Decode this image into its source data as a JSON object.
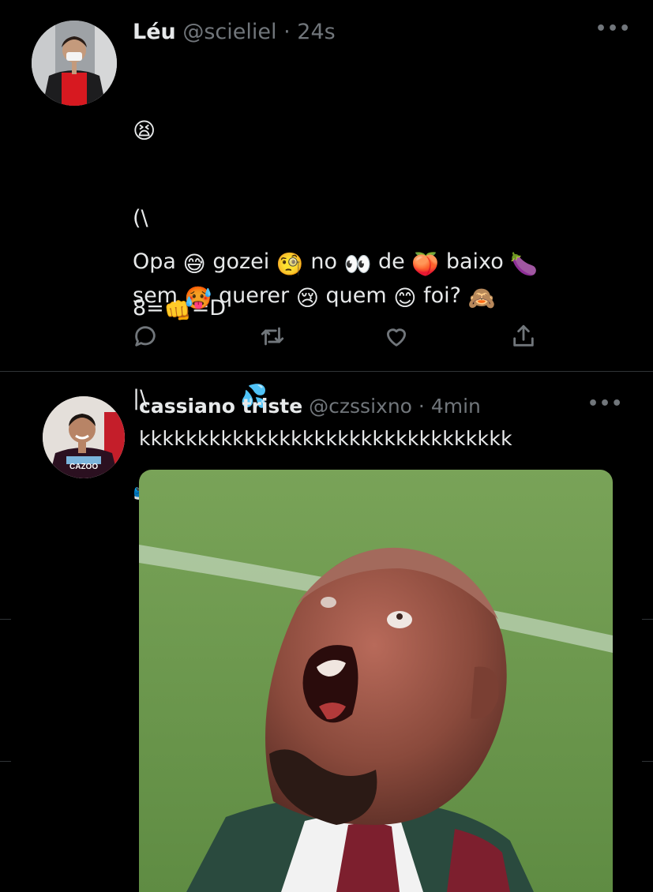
{
  "tweets": [
    {
      "display_name": "Léu",
      "handle": "@scieliel",
      "separator": "·",
      "time": "24s",
      "more": "•••",
      "lines": [
        {
          "text": "(\\"
        },
        {
          "left": "8=",
          "right": "=D"
        },
        {
          "text": "|\\"
        }
      ],
      "sentence": {
        "w1": "Opa",
        "w2": "gozei",
        "w3": "no",
        "w4": "de",
        "w5": "baixo",
        "w6": "sem",
        "w7": "querer",
        "w8": "quem",
        "w9": "foi?"
      },
      "icons": {
        "tired": "tired-face-emoji",
        "fist": "oncoming-fist-emoji",
        "sweat": "sweat-droplets-emoji",
        "shoe": "sneaker-emoji",
        "grin_sweat": "grinning-face-with-sweat-emoji",
        "monocle": "face-with-monocle-emoji",
        "eyes": "eyes-emoji",
        "peach": "peach-emoji",
        "eggplant": "eggplant-emoji",
        "hot": "hot-face-emoji",
        "crying": "crying-face-emoji",
        "smile": "smiling-face-emoji",
        "monkey": "see-no-evil-monkey-emoji"
      },
      "actions": [
        "reply-icon",
        "retweet-icon",
        "like-icon",
        "share-icon"
      ]
    },
    {
      "display_name": "cassiano triste",
      "handle": "@czssixno",
      "separator": "·",
      "time": "4min",
      "more": "•••",
      "text": "kkkkkkkkkkkkkkkkkkkkkkkkkkkkkkkk",
      "avatar_jersey_text": "CAZOO"
    }
  ],
  "colors": {
    "background": "#000000",
    "text": "#e7e9ea",
    "secondary": "#71767b",
    "divider": "#2f3336",
    "pitch_green": "#6f9a4e"
  }
}
